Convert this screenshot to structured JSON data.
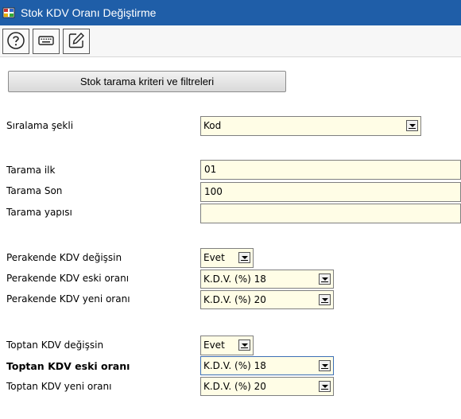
{
  "window": {
    "title": "Stok KDV Oranı Değiştirme"
  },
  "toolbar": {
    "help_icon": "help-circle-icon",
    "keyboard_icon": "keyboard-icon",
    "edit_icon": "edit-icon"
  },
  "filter_button": {
    "label": "Stok tarama kriteri ve filtreleri"
  },
  "form": {
    "sort_label": "Sıralama şekli",
    "sort_value": "Kod",
    "scan_first_label": "Tarama ilk",
    "scan_first_value": "01",
    "scan_last_label": "Tarama Son",
    "scan_last_value": "100",
    "scan_structure_label": "Tarama yapısı",
    "scan_structure_value": "",
    "retail_change_label": "Perakende KDV değişsin",
    "retail_change_value": "Evet",
    "retail_old_label": "Perakende KDV eski oranı",
    "retail_old_value": "K.D.V. (%) 18",
    "retail_new_label": "Perakende KDV yeni oranı",
    "retail_new_value": "K.D.V. (%) 20",
    "wholesale_change_label": "Toptan KDV değişsin",
    "wholesale_change_value": "Evet",
    "wholesale_old_label": "Toptan KDV eski oranı",
    "wholesale_old_value": "K.D.V. (%) 18",
    "wholesale_new_label": "Toptan KDV yeni oranı",
    "wholesale_new_value": "K.D.V. (%) 20"
  },
  "colors": {
    "titlebar": "#1f5ea8",
    "field_bg": "#fffde6",
    "focus_border": "#3d6fb5"
  }
}
